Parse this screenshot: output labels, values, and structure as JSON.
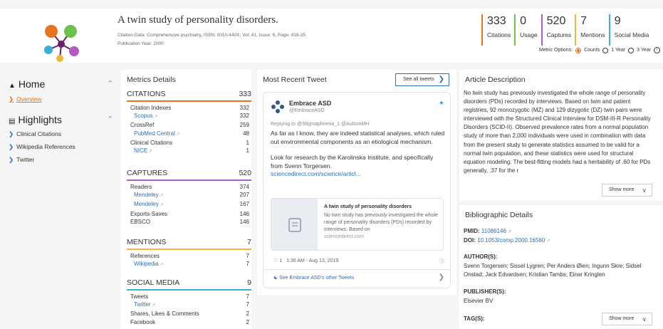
{
  "header": {
    "title": "A twin study of personality disorders.",
    "citation_data": "Citation Data: Comprehensive psychiatry, ISSN: 0010-440X, Vol: 41, Issue: 6, Page: 416-25",
    "publication_year": "Publication Year: 2000",
    "metrics": [
      {
        "value": "333",
        "label": "Citations",
        "color": "#e8731e"
      },
      {
        "value": "0",
        "label": "Usage",
        "color": "#6cc24a"
      },
      {
        "value": "520",
        "label": "Captures",
        "color": "#b45cc4"
      },
      {
        "value": "7",
        "label": "Mentions",
        "color": "#f2b43a"
      },
      {
        "value": "9",
        "label": "Social Media",
        "color": "#3ab0d8"
      }
    ],
    "metric_options_label": "Metric Options:",
    "metric_options": [
      "Counts",
      "1 Year",
      "3 Year"
    ],
    "metric_options_selected": "Counts"
  },
  "nav": {
    "home": "Home",
    "overview": "Overview",
    "highlights": "Highlights",
    "highlight_items": [
      "Clinical Citations",
      "Wikipedia References",
      "Twitter"
    ]
  },
  "metrics_panel": {
    "title": "Metrics Details",
    "sections": [
      {
        "name": "CITATIONS",
        "total": "333",
        "color": "#e8731e",
        "rows": [
          {
            "label": "Citation Indexes",
            "value": "332",
            "link": false
          },
          {
            "label": "Scopus",
            "value": "332",
            "link": true
          },
          {
            "label": "CrossRef",
            "value": "259",
            "link": false
          },
          {
            "label": "PubMed Central",
            "value": "48",
            "link": true
          },
          {
            "label": "Clinical Citations",
            "value": "1",
            "link": false
          },
          {
            "label": "NICE",
            "value": "1",
            "link": true
          }
        ]
      },
      {
        "name": "CAPTURES",
        "total": "520",
        "color": "#b45cc4",
        "rows": [
          {
            "label": "Readers",
            "value": "374",
            "link": false
          },
          {
            "label": "Mendeley",
            "value": "207",
            "link": true
          },
          {
            "label": "Mendeley",
            "value": "167",
            "link": true
          },
          {
            "label": "Exports-Saves",
            "value": "146",
            "link": false
          },
          {
            "label": "EBSCO",
            "value": "146",
            "link": false
          }
        ]
      },
      {
        "name": "MENTIONS",
        "total": "7",
        "color": "#f2b43a",
        "rows": [
          {
            "label": "References",
            "value": "7",
            "link": false
          },
          {
            "label": "Wikipedia",
            "value": "7",
            "link": true
          }
        ]
      },
      {
        "name": "SOCIAL MEDIA",
        "total": "9",
        "color": "#3ab0d8",
        "rows": [
          {
            "label": "Tweets",
            "value": "7",
            "link": false
          },
          {
            "label": "Twitter",
            "value": "7",
            "link": true
          },
          {
            "label": "Shares, Likes & Comments",
            "value": "2",
            "link": false
          },
          {
            "label": "Facebook",
            "value": "2",
            "link": false
          }
        ]
      }
    ]
  },
  "tweet_panel": {
    "title": "Most Recent Tweet",
    "see_all": "See all tweets",
    "name": "Embrace ASD",
    "handle": "@EmbraceASD",
    "reply": "Replying to @Stigmaphrenia_1 @AutismMH",
    "text1": "As far as I know, they are indeed statistical analyses, which ruled out environmental components as an etiological mechanism.",
    "text2": "Look for research by the Karolinska Institute, and specifically from Svenn Torgersen.",
    "link": "sciencedirect.com/science/articl...",
    "card_title": "A twin study of personality disorders",
    "card_desc": "No twin study has previously investigated the whole range of personality disorders (PDs) recorded by interviews. Based on",
    "card_domain": "sciencedirect.com",
    "likes": "1",
    "time": "1:36 AM - Aug 13, 2019",
    "more": "See Embrace ASD's other Tweets"
  },
  "article_panel": {
    "title": "Article Description",
    "abstract": "No twin study has previously investigated the whole range of personality disorders (PDs) recorded by interviews. Based on twin and patient registries, 92 monozygotic (MZ) and 129 dizygotic (DZ) twin pairs were interviewed with the Structured Clinical Interview for DSM-III-R Personality Disorders (SCID-II). Observed prevalence rates from a normal population study of more than 2,000 individuals were used in combination with data from the present study to generate statistics assumed to be valid for a normal twin population, and these statistics were used for structural equation modeling. The best-fitting models had a heritability of .60 for PDs generally, .37 for the r",
    "show_more": "Show more"
  },
  "biblio_panel": {
    "title": "Bibliographic Details",
    "pmid_label": "PMID:",
    "pmid": "11086146",
    "doi_label": "DOI:",
    "doi": "10.1053/comp.2000.16560",
    "authors_label": "AUTHOR(S):",
    "authors": "Svenn Torgersen; Sissel Lygren; Per Anders Øien; Ingunn Skre; Sidsel Onstad; Jack Edvardsen; Kristian Tambs; Einar Kringlen",
    "publisher_label": "PUBLISHER(S):",
    "publisher": "Elsevier BV",
    "tags_label": "TAG(S):",
    "show_more": "Show more"
  }
}
